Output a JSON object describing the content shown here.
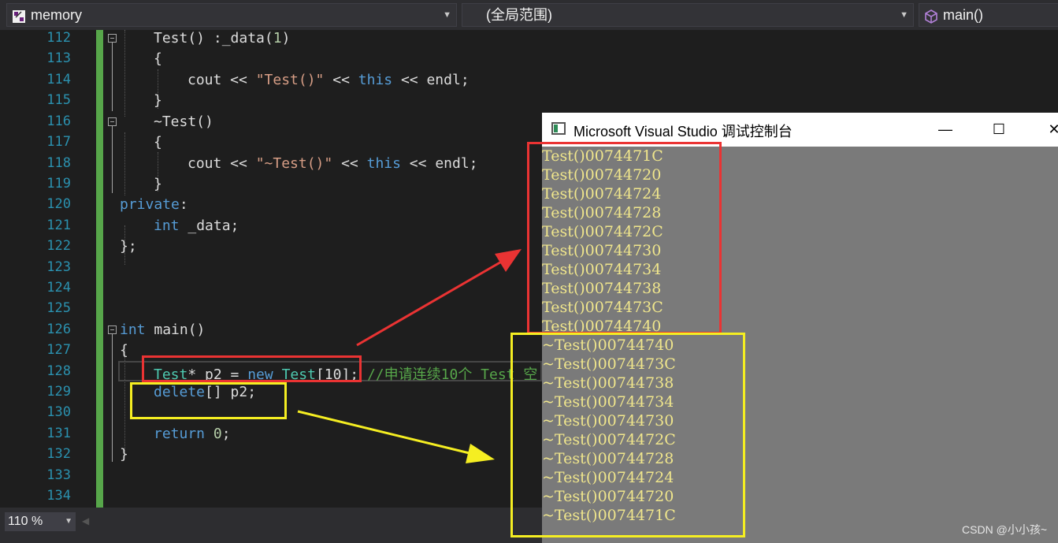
{
  "navbar": {
    "project": "memory",
    "scope": "(全局范围)",
    "function": "main()"
  },
  "editor": {
    "line_numbers": [
      "112",
      "113",
      "114",
      "115",
      "116",
      "117",
      "118",
      "119",
      "120",
      "121",
      "122",
      "123",
      "124",
      "125",
      "126",
      "127",
      "128",
      "129",
      "130",
      "131",
      "132",
      "133",
      "134"
    ],
    "code": {
      "l112": {
        "a": "Test() :_data(",
        "b": "1",
        "c": ")"
      },
      "l113": "{",
      "l114": {
        "a": "cout << ",
        "b": "\"Test()\"",
        "c": " << ",
        "d": "this",
        "e": " << endl;"
      },
      "l115": "}",
      "l116": "~Test()",
      "l117": "{",
      "l118": {
        "a": "cout << ",
        "b": "\"~Test()\"",
        "c": " << ",
        "d": "this",
        "e": " << endl;"
      },
      "l119": "}",
      "l120": {
        "a": "private",
        "b": ":"
      },
      "l121": {
        "a": "int",
        "b": " _data;"
      },
      "l122": "};",
      "l126": {
        "a": "int",
        "b": " main()"
      },
      "l127": "{",
      "l128": {
        "a": "Test",
        "b": "* p2 = ",
        "c": "new",
        "d": " ",
        "e": "Test",
        "f": "[10]; ",
        "g": "//申请连续10个 Test 空"
      },
      "l129": {
        "a": "delete",
        "b": "[] p2;"
      },
      "l131": {
        "a": "return",
        "b": " ",
        "c": "0",
        "d": ";"
      },
      "l132": "}"
    }
  },
  "statusbar": {
    "zoom": "110 %"
  },
  "console": {
    "title": "Microsoft Visual Studio 调试控制台",
    "minimize": "—",
    "maximize": "☐",
    "close": "✕",
    "lines": [
      "Test()0074471C",
      "Test()00744720",
      "Test()00744724",
      "Test()00744728",
      "Test()0074472C",
      "Test()00744730",
      "Test()00744734",
      "Test()00744738",
      "Test()0074473C",
      "Test()00744740",
      "~Test()00744740",
      "~Test()0074473C",
      "~Test()00744738",
      "~Test()00744734",
      "~Test()00744730",
      "~Test()0074472C",
      "~Test()00744728",
      "~Test()00744724",
      "~Test()00744720",
      "~Test()0074471C"
    ]
  },
  "watermark": "CSDN @小小孩~",
  "colors": {
    "annotation_red": "#ea3333",
    "annotation_yellow": "#f5ee22",
    "console_text": "#f0e68c",
    "keyword": "#569cd6",
    "type": "#4ec9b0",
    "string": "#d69d85",
    "comment": "#57a64a"
  }
}
